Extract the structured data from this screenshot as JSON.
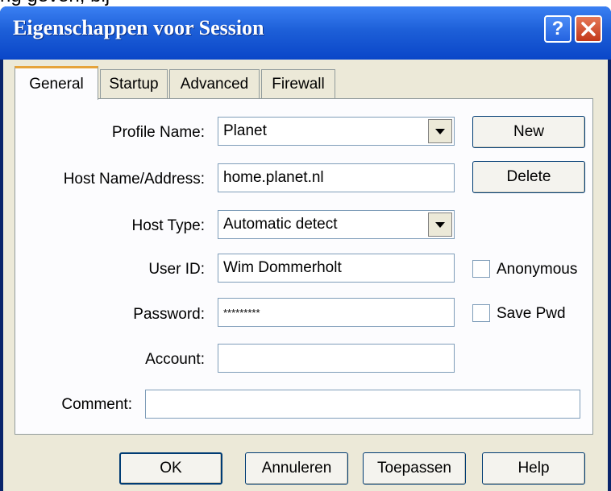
{
  "top_clip": {
    "text": "ng geven, bij"
  },
  "window": {
    "title": "Eigenschappen voor Session",
    "help_button": "?",
    "close_button": "×"
  },
  "tabs": [
    {
      "label": "General",
      "active": true
    },
    {
      "label": "Startup",
      "active": false
    },
    {
      "label": "Advanced",
      "active": false
    },
    {
      "label": "Firewall",
      "active": false
    }
  ],
  "form": {
    "profile_name": {
      "label": "Profile Name:",
      "value": "Planet"
    },
    "host_name": {
      "label": "Host Name/Address:",
      "value": "home.planet.nl"
    },
    "host_type": {
      "label": "Host Type:",
      "value": "Automatic detect"
    },
    "user_id": {
      "label": "User ID:",
      "value": "Wim Dommerholt"
    },
    "password": {
      "label": "Password:",
      "value": "*********"
    },
    "account": {
      "label": "Account:",
      "value": ""
    },
    "comment": {
      "label": "Comment:",
      "value": ""
    },
    "anonymous": {
      "label": "Anonymous",
      "checked": false
    },
    "save_pwd": {
      "label": "Save Pwd",
      "checked": false
    }
  },
  "side_buttons": {
    "new": "New",
    "delete": "Delete"
  },
  "footer": {
    "ok": "OK",
    "cancel": "Annuleren",
    "apply": "Toepassen",
    "help": "Help"
  }
}
